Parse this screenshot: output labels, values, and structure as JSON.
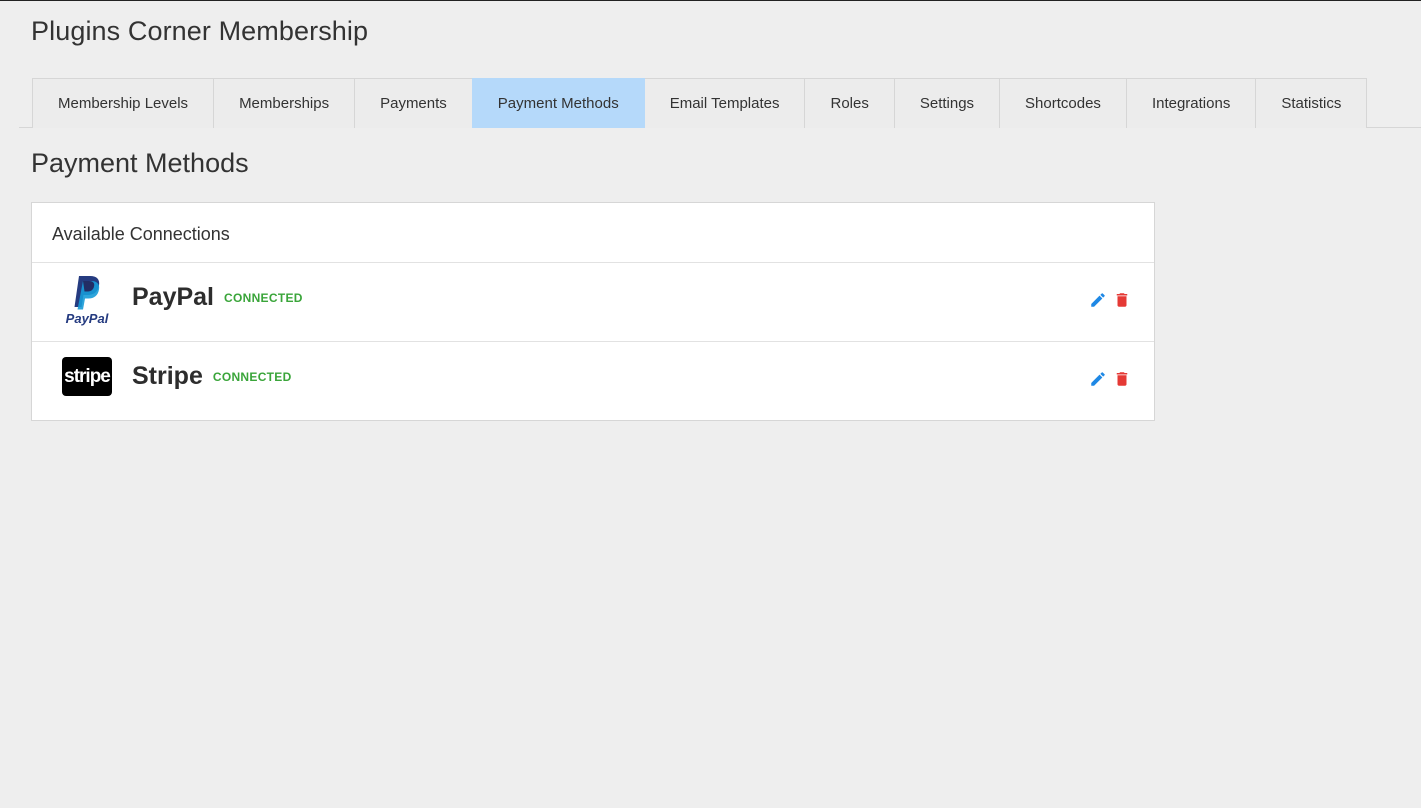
{
  "app": {
    "title": "Plugins Corner Membership"
  },
  "tabs": [
    {
      "label": "Membership Levels",
      "active": false
    },
    {
      "label": "Memberships",
      "active": false
    },
    {
      "label": "Payments",
      "active": false
    },
    {
      "label": "Payment Methods",
      "active": true
    },
    {
      "label": "Email Templates",
      "active": false
    },
    {
      "label": "Roles",
      "active": false
    },
    {
      "label": "Settings",
      "active": false
    },
    {
      "label": "Shortcodes",
      "active": false
    },
    {
      "label": "Integrations",
      "active": false
    },
    {
      "label": "Statistics",
      "active": false
    }
  ],
  "section": {
    "title": "Payment Methods"
  },
  "panel": {
    "header": "Available Connections",
    "connections": [
      {
        "name": "PayPal",
        "status": "CONNECTED",
        "logo": "paypal-logo",
        "logo_text": "PayPal",
        "edit_icon": "pencil-icon",
        "delete_icon": "trash-icon"
      },
      {
        "name": "Stripe",
        "status": "CONNECTED",
        "logo": "stripe-logo",
        "logo_text": "stripe",
        "edit_icon": "pencil-icon",
        "delete_icon": "trash-icon"
      }
    ]
  },
  "colors": {
    "background": "#eeeeee",
    "active_tab": "#b5d9fa",
    "status_connected": "#3aa53a",
    "edit_icon": "#1e88e5",
    "delete_icon": "#e53935",
    "paypal_dark_blue": "#253b80",
    "paypal_light_blue": "#179bd7"
  }
}
